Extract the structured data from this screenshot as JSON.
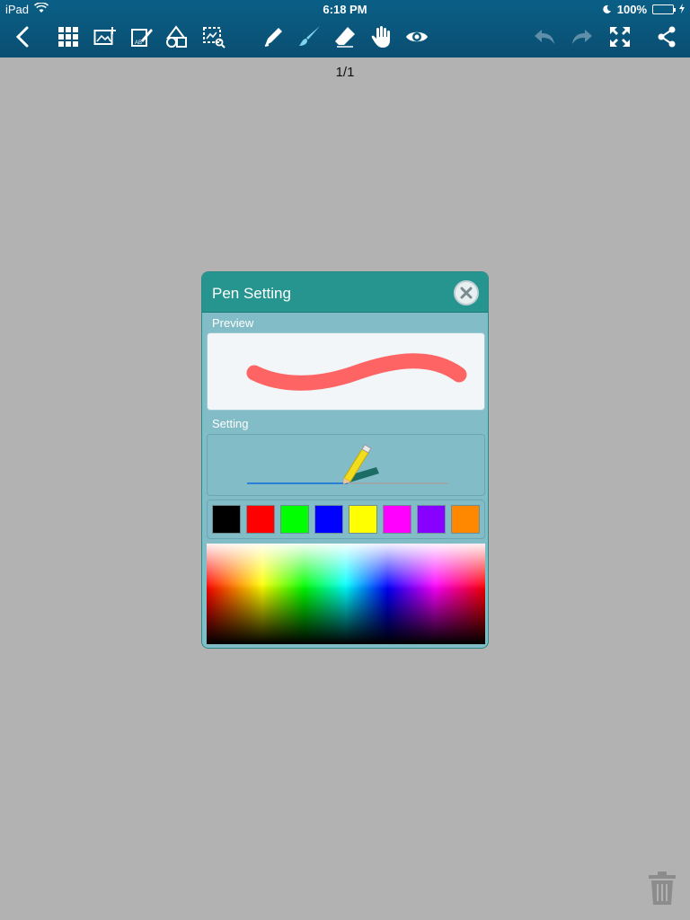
{
  "status": {
    "device": "iPad",
    "time": "6:18 PM",
    "battery": "100%",
    "battery_level": 1.0
  },
  "toolbar": {
    "items": [
      {
        "icon": "back-icon"
      },
      {
        "icon": "grid-icon"
      },
      {
        "icon": "add-image-icon"
      },
      {
        "icon": "edit-text-icon"
      },
      {
        "icon": "shapes-icon"
      },
      {
        "icon": "select-region-icon"
      },
      {
        "icon": "pen-icon"
      },
      {
        "icon": "brush-icon"
      },
      {
        "icon": "eraser-icon"
      },
      {
        "icon": "hand-icon"
      },
      {
        "icon": "eye-icon"
      },
      {
        "icon": "undo-icon"
      },
      {
        "icon": "redo-icon"
      },
      {
        "icon": "fullscreen-icon"
      },
      {
        "icon": "share-icon"
      }
    ]
  },
  "page_indicator": "1/1",
  "dialog": {
    "title": "Pen Setting",
    "preview_label": "Preview",
    "setting_label": "Setting",
    "stroke_color": "#ff6464",
    "slider_value": 0.5,
    "swatches": [
      "#000000",
      "#ff0000",
      "#00ff00",
      "#0000ff",
      "#ffff00",
      "#ff00ff",
      "#8800ff",
      "#ff8800"
    ]
  },
  "colors": {
    "toolbar_bg": "#0a5f86",
    "dialog_header": "#27958f",
    "dialog_body": "#82bcc6",
    "canvas_bg": "#b2b2b2"
  }
}
